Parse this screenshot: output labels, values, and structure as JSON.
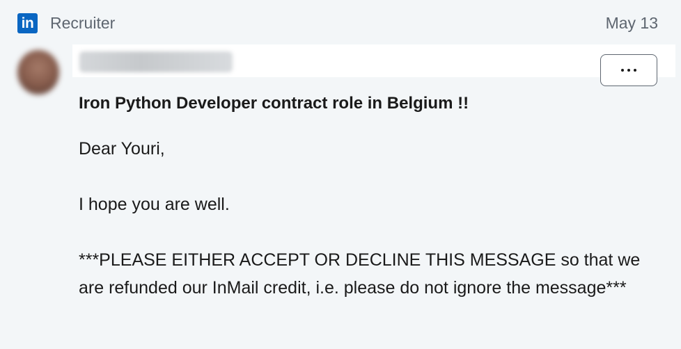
{
  "header": {
    "logo_text": "in",
    "source": "Recruiter",
    "date": "May 13"
  },
  "sender": {
    "name_redacted": true
  },
  "actions": {
    "more_icon": "ellipsis-icon"
  },
  "message": {
    "subject": "Iron Python Developer contract role in Belgium !!",
    "greeting": "Dear Youri,",
    "line1": "I hope you are well.",
    "notice": "***PLEASE EITHER ACCEPT OR DECLINE THIS MESSAGE so that we are refunded our InMail credit, i.e. please do not ignore the message***"
  },
  "colors": {
    "linkedin_blue": "#0a66c2",
    "background": "#f3f6f8",
    "muted_text": "#5e6670"
  }
}
